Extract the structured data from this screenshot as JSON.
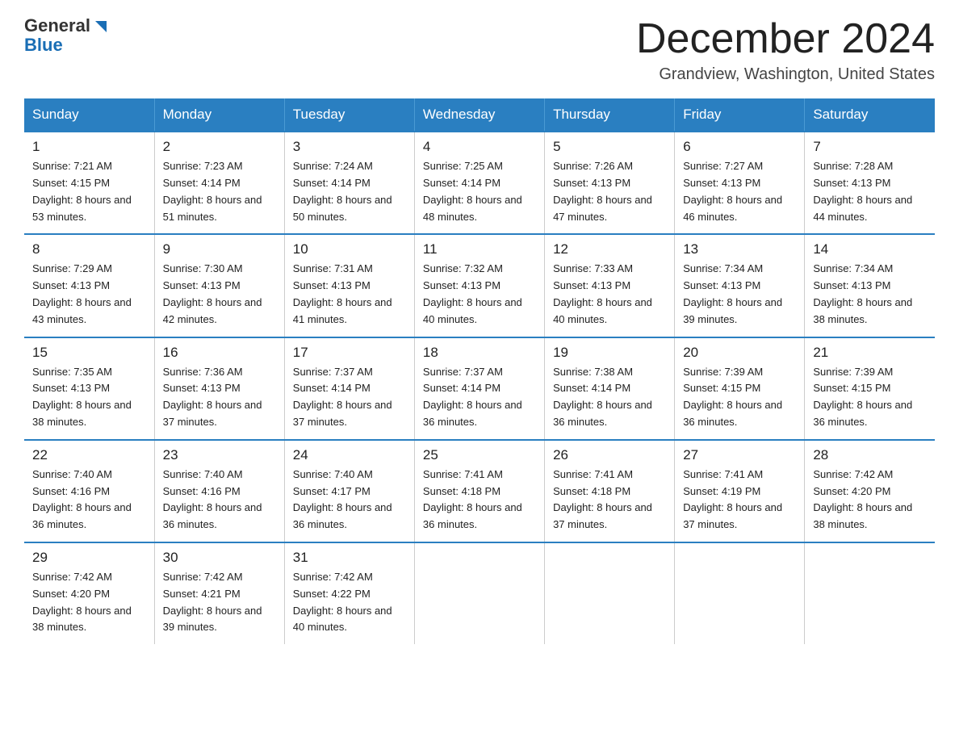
{
  "header": {
    "logo_general": "General",
    "logo_blue": "Blue",
    "month_title": "December 2024",
    "location": "Grandview, Washington, United States"
  },
  "weekdays": [
    "Sunday",
    "Monday",
    "Tuesday",
    "Wednesday",
    "Thursday",
    "Friday",
    "Saturday"
  ],
  "weeks": [
    [
      {
        "day": "1",
        "sunrise": "Sunrise: 7:21 AM",
        "sunset": "Sunset: 4:15 PM",
        "daylight": "Daylight: 8 hours and 53 minutes."
      },
      {
        "day": "2",
        "sunrise": "Sunrise: 7:23 AM",
        "sunset": "Sunset: 4:14 PM",
        "daylight": "Daylight: 8 hours and 51 minutes."
      },
      {
        "day": "3",
        "sunrise": "Sunrise: 7:24 AM",
        "sunset": "Sunset: 4:14 PM",
        "daylight": "Daylight: 8 hours and 50 minutes."
      },
      {
        "day": "4",
        "sunrise": "Sunrise: 7:25 AM",
        "sunset": "Sunset: 4:14 PM",
        "daylight": "Daylight: 8 hours and 48 minutes."
      },
      {
        "day": "5",
        "sunrise": "Sunrise: 7:26 AM",
        "sunset": "Sunset: 4:13 PM",
        "daylight": "Daylight: 8 hours and 47 minutes."
      },
      {
        "day": "6",
        "sunrise": "Sunrise: 7:27 AM",
        "sunset": "Sunset: 4:13 PM",
        "daylight": "Daylight: 8 hours and 46 minutes."
      },
      {
        "day": "7",
        "sunrise": "Sunrise: 7:28 AM",
        "sunset": "Sunset: 4:13 PM",
        "daylight": "Daylight: 8 hours and 44 minutes."
      }
    ],
    [
      {
        "day": "8",
        "sunrise": "Sunrise: 7:29 AM",
        "sunset": "Sunset: 4:13 PM",
        "daylight": "Daylight: 8 hours and 43 minutes."
      },
      {
        "day": "9",
        "sunrise": "Sunrise: 7:30 AM",
        "sunset": "Sunset: 4:13 PM",
        "daylight": "Daylight: 8 hours and 42 minutes."
      },
      {
        "day": "10",
        "sunrise": "Sunrise: 7:31 AM",
        "sunset": "Sunset: 4:13 PM",
        "daylight": "Daylight: 8 hours and 41 minutes."
      },
      {
        "day": "11",
        "sunrise": "Sunrise: 7:32 AM",
        "sunset": "Sunset: 4:13 PM",
        "daylight": "Daylight: 8 hours and 40 minutes."
      },
      {
        "day": "12",
        "sunrise": "Sunrise: 7:33 AM",
        "sunset": "Sunset: 4:13 PM",
        "daylight": "Daylight: 8 hours and 40 minutes."
      },
      {
        "day": "13",
        "sunrise": "Sunrise: 7:34 AM",
        "sunset": "Sunset: 4:13 PM",
        "daylight": "Daylight: 8 hours and 39 minutes."
      },
      {
        "day": "14",
        "sunrise": "Sunrise: 7:34 AM",
        "sunset": "Sunset: 4:13 PM",
        "daylight": "Daylight: 8 hours and 38 minutes."
      }
    ],
    [
      {
        "day": "15",
        "sunrise": "Sunrise: 7:35 AM",
        "sunset": "Sunset: 4:13 PM",
        "daylight": "Daylight: 8 hours and 38 minutes."
      },
      {
        "day": "16",
        "sunrise": "Sunrise: 7:36 AM",
        "sunset": "Sunset: 4:13 PM",
        "daylight": "Daylight: 8 hours and 37 minutes."
      },
      {
        "day": "17",
        "sunrise": "Sunrise: 7:37 AM",
        "sunset": "Sunset: 4:14 PM",
        "daylight": "Daylight: 8 hours and 37 minutes."
      },
      {
        "day": "18",
        "sunrise": "Sunrise: 7:37 AM",
        "sunset": "Sunset: 4:14 PM",
        "daylight": "Daylight: 8 hours and 36 minutes."
      },
      {
        "day": "19",
        "sunrise": "Sunrise: 7:38 AM",
        "sunset": "Sunset: 4:14 PM",
        "daylight": "Daylight: 8 hours and 36 minutes."
      },
      {
        "day": "20",
        "sunrise": "Sunrise: 7:39 AM",
        "sunset": "Sunset: 4:15 PM",
        "daylight": "Daylight: 8 hours and 36 minutes."
      },
      {
        "day": "21",
        "sunrise": "Sunrise: 7:39 AM",
        "sunset": "Sunset: 4:15 PM",
        "daylight": "Daylight: 8 hours and 36 minutes."
      }
    ],
    [
      {
        "day": "22",
        "sunrise": "Sunrise: 7:40 AM",
        "sunset": "Sunset: 4:16 PM",
        "daylight": "Daylight: 8 hours and 36 minutes."
      },
      {
        "day": "23",
        "sunrise": "Sunrise: 7:40 AM",
        "sunset": "Sunset: 4:16 PM",
        "daylight": "Daylight: 8 hours and 36 minutes."
      },
      {
        "day": "24",
        "sunrise": "Sunrise: 7:40 AM",
        "sunset": "Sunset: 4:17 PM",
        "daylight": "Daylight: 8 hours and 36 minutes."
      },
      {
        "day": "25",
        "sunrise": "Sunrise: 7:41 AM",
        "sunset": "Sunset: 4:18 PM",
        "daylight": "Daylight: 8 hours and 36 minutes."
      },
      {
        "day": "26",
        "sunrise": "Sunrise: 7:41 AM",
        "sunset": "Sunset: 4:18 PM",
        "daylight": "Daylight: 8 hours and 37 minutes."
      },
      {
        "day": "27",
        "sunrise": "Sunrise: 7:41 AM",
        "sunset": "Sunset: 4:19 PM",
        "daylight": "Daylight: 8 hours and 37 minutes."
      },
      {
        "day": "28",
        "sunrise": "Sunrise: 7:42 AM",
        "sunset": "Sunset: 4:20 PM",
        "daylight": "Daylight: 8 hours and 38 minutes."
      }
    ],
    [
      {
        "day": "29",
        "sunrise": "Sunrise: 7:42 AM",
        "sunset": "Sunset: 4:20 PM",
        "daylight": "Daylight: 8 hours and 38 minutes."
      },
      {
        "day": "30",
        "sunrise": "Sunrise: 7:42 AM",
        "sunset": "Sunset: 4:21 PM",
        "daylight": "Daylight: 8 hours and 39 minutes."
      },
      {
        "day": "31",
        "sunrise": "Sunrise: 7:42 AM",
        "sunset": "Sunset: 4:22 PM",
        "daylight": "Daylight: 8 hours and 40 minutes."
      },
      null,
      null,
      null,
      null
    ]
  ]
}
